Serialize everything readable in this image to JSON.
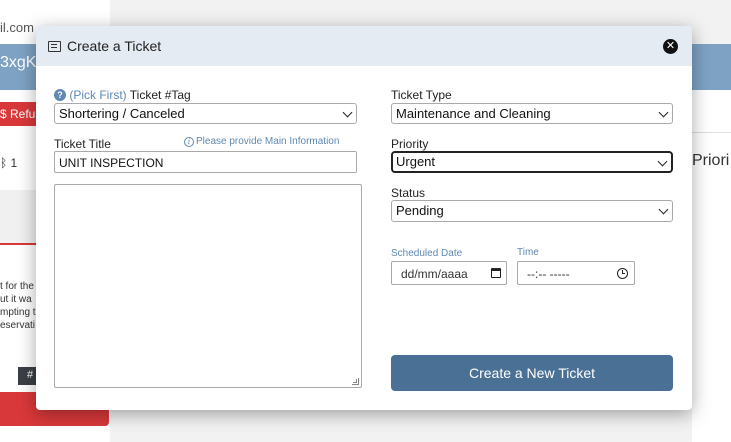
{
  "background": {
    "email_fragment": "il.com",
    "code_fragment": "3xgK",
    "refund_label": "$ Refun",
    "count_fragment": "ᛒ 1",
    "text_lines": [
      "t for the",
      "ut it wa",
      "mpting t",
      "eservati"
    ],
    "hash_badge": "#",
    "priority_fragment": "Priori"
  },
  "modal": {
    "title": "Create a Ticket",
    "close_symbol": "✕",
    "ticket_tag": {
      "help_symbol": "?",
      "pick_first": "(Pick First)",
      "label": "Ticket #Tag",
      "value": "Shortering / Canceled"
    },
    "ticket_title": {
      "label": "Ticket Title",
      "info_symbol": "i",
      "info_note": "Please provide Main Information",
      "value": "UNIT INSPECTION"
    },
    "description": {
      "value": ""
    },
    "ticket_type": {
      "label": "Ticket Type",
      "value": "Maintenance and Cleaning"
    },
    "priority": {
      "label": "Priority",
      "value": "Urgent"
    },
    "status": {
      "label": "Status",
      "value": "Pending"
    },
    "scheduled_date": {
      "label": "Scheduled Date",
      "placeholder": "dd/mm/aaaa"
    },
    "time": {
      "label": "Time",
      "placeholder": "--:-- -----"
    },
    "submit_label": "Create a New Ticket"
  },
  "colors": {
    "accent": "#5f88b3",
    "button": "#4a7096",
    "header_bg": "#e4ebf3",
    "danger": "#d9383a"
  }
}
